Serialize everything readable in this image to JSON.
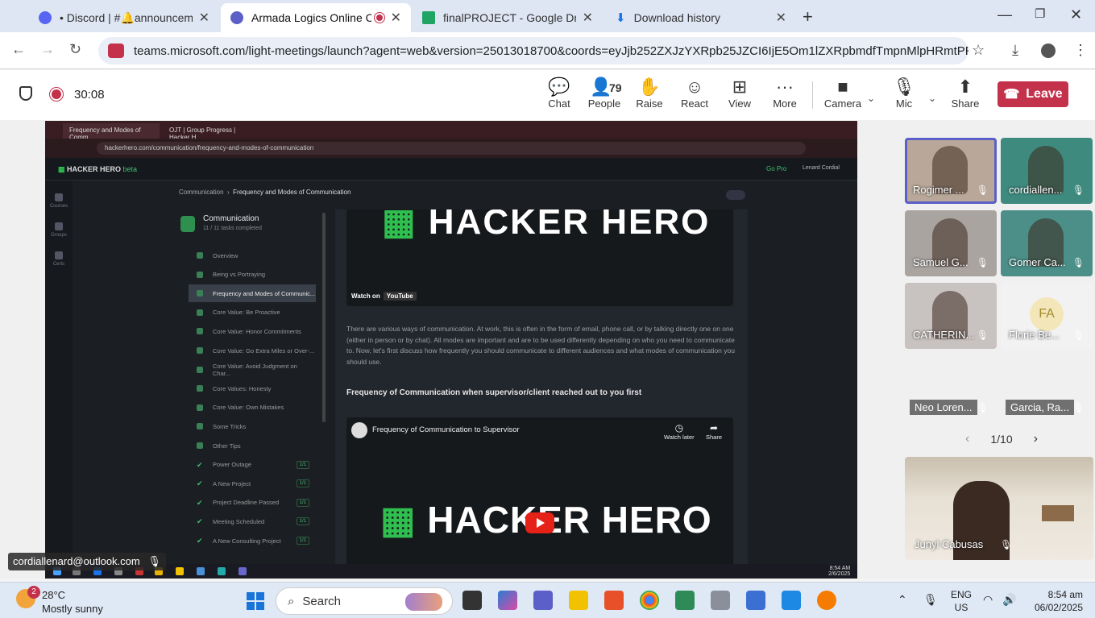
{
  "browser": {
    "tabs": [
      {
        "title": "• Discord | #🔔announcements",
        "color": "#5865f2"
      },
      {
        "title": "Armada Logics Online Codi",
        "color": "#5b5fc7",
        "recording": true
      },
      {
        "title": "finalPROJECT - Google Drive",
        "color": "#1fa463"
      },
      {
        "title": "Download history",
        "color": "#1a73e8"
      }
    ],
    "url": "teams.microsoft.com/light-meetings/launch?agent=web&version=25013018700&coords=eyJjb252ZXJzYXRpb25JZCI6IjE5Om1lZXRpbmdfTmpnMlpHRmtPRGd0T1Rn..."
  },
  "teams": {
    "timer": "30:08",
    "buttons": {
      "chat": "Chat",
      "people": "People",
      "people_count": "79",
      "raise": "Raise",
      "react": "React",
      "view": "View",
      "more": "More",
      "camera": "Camera",
      "mic": "Mic",
      "share": "Share",
      "leave": "Leave"
    }
  },
  "shared_screen": {
    "tabs": [
      "Frequency and Modes of Comm",
      "OJT | Group Progress | Hacker H"
    ],
    "url": "hackerhero.com/communication/frequency-and-modes-of-communication",
    "logo": "HACKER HERO",
    "logo_tag": "beta",
    "go_pro": "Go Pro",
    "user": "Lenard Cordial",
    "rail": [
      "Courses",
      "Groups",
      "Certs"
    ],
    "breadcrumb_root": "Communication",
    "breadcrumb_current": "Frequency and Modes of Communication",
    "sidebar_title": "Communication",
    "sidebar_sub": "11 / 11 tasks completed",
    "items": [
      {
        "label": "Overview",
        "done": false,
        "badge": ""
      },
      {
        "label": "Being vs Portraying",
        "done": false,
        "badge": ""
      },
      {
        "label": "Frequency and Modes of Communic...",
        "done": false,
        "badge": "",
        "active": true
      },
      {
        "label": "Core Value: Be Proactive",
        "done": false,
        "badge": ""
      },
      {
        "label": "Core Value: Honor Commitments",
        "done": false,
        "badge": ""
      },
      {
        "label": "Core Value: Go Extra Miles or Over-...",
        "done": false,
        "badge": ""
      },
      {
        "label": "Core Value: Avoid Judgment on Char...",
        "done": false,
        "badge": ""
      },
      {
        "label": "Core Values: Honesty",
        "done": false,
        "badge": ""
      },
      {
        "label": "Core Value: Own Mistakes",
        "done": false,
        "badge": ""
      },
      {
        "label": "Some Tricks",
        "done": false,
        "badge": ""
      },
      {
        "label": "Other Tips",
        "done": false,
        "badge": ""
      },
      {
        "label": "Power Outage",
        "done": true,
        "badge": "1/1"
      },
      {
        "label": "A New Project",
        "done": true,
        "badge": "1/1"
      },
      {
        "label": "Project Deadline Passed",
        "done": true,
        "badge": "1/1"
      },
      {
        "label": "Meeting Scheduled",
        "done": true,
        "badge": "1/1"
      },
      {
        "label": "A New Consulting Project",
        "done": true,
        "badge": "1/1"
      }
    ],
    "video_top_brand": "HACKER HERO",
    "watch_on": "Watch on",
    "youtube": "YouTube",
    "paragraph": "There are various ways of communication. At work, this is often in the form of email, phone call, or by talking directly one on one (either in person or by chat). All modes are important and are to be used differently depending on who you need to communicate to. Now, let's first discuss how frequently you should communicate to different audiences and what modes of communication you should use.",
    "heading": "Frequency of Communication when supervisor/client reached out to you first",
    "video2_title": "Frequency of Communication to Supervisor",
    "watch_later": "Watch later",
    "share": "Share",
    "video2_brand": "HACKER HERO",
    "clock_time": "8:54 AM",
    "clock_date": "2/6/2025"
  },
  "presenter": "cordiallenard@outlook.com",
  "participants": [
    {
      "name": "Rogimer ...",
      "bg": "#b9a89a",
      "selected": true
    },
    {
      "name": "cordiallen...",
      "bg": "#3f8a7e"
    },
    {
      "name": "Samuel G...",
      "bg": "#a9a4a0"
    },
    {
      "name": "Gomer Ca...",
      "bg": "#4b8f88"
    },
    {
      "name": "CATHERIN...",
      "bg": "#c8c2c0"
    },
    {
      "name": "Florie Be...",
      "bg": "#f2f2f2",
      "initials": "FA"
    },
    {
      "name": "Neo Loren...",
      "bg": "#f0f0f0"
    },
    {
      "name": "Garcia, Ra...",
      "bg": "#f0f0f0"
    }
  ],
  "pager": "1/10",
  "big_tile_name": "Junyl Cabusas",
  "taskbar": {
    "temp": "28°C",
    "weather": "Mostly sunny",
    "weather_badge": "2",
    "search": "Search",
    "lang1": "ENG",
    "lang2": "US",
    "time": "8:54 am",
    "date": "06/02/2025"
  }
}
